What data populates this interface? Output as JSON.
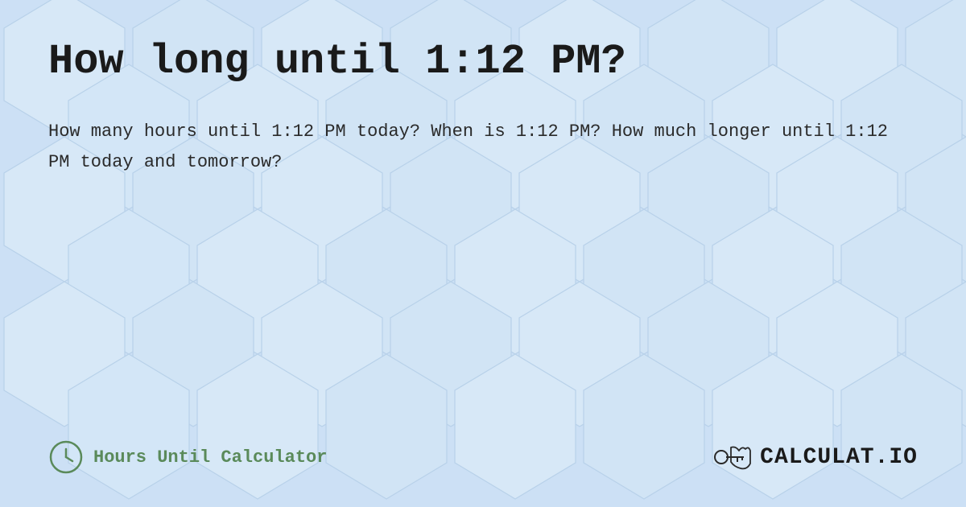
{
  "page": {
    "title": "How long until 1:12 PM?",
    "description": "How many hours until 1:12 PM today? When is 1:12 PM? How much longer until 1:12 PM today and tomorrow?",
    "background_color": "#cce0f5",
    "accent_color": "#5a8a5a"
  },
  "footer": {
    "label": "Hours Until Calculator",
    "logo_text": "CALCULAT.IO",
    "clock_icon": "clock-icon",
    "logo_icon": "calculator-logo-icon"
  }
}
